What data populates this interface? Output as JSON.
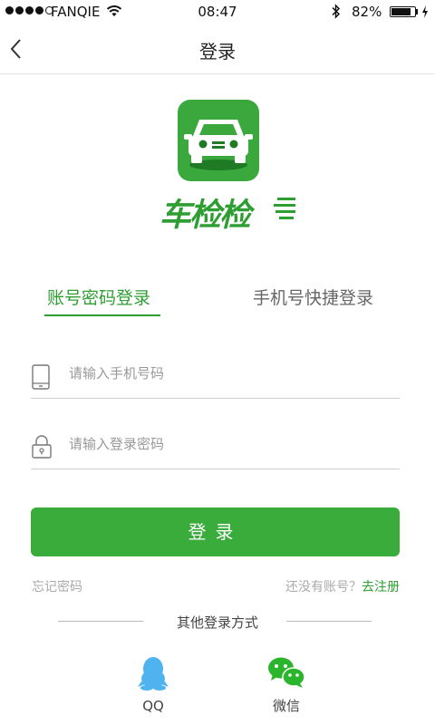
{
  "status_bar": {
    "carrier": "FANQIE",
    "time": "08:47",
    "battery": "82%"
  },
  "nav": {
    "title": "登录"
  },
  "brand": {
    "name": "车检检",
    "color": "#2e9e33"
  },
  "tabs": [
    {
      "label": "账号密码登录",
      "active": true
    },
    {
      "label": "手机号快捷登录",
      "active": false
    }
  ],
  "form": {
    "phone": {
      "value": "",
      "placeholder": "请输入手机号码"
    },
    "password": {
      "value": "",
      "placeholder": "请输入登录密码"
    },
    "submit_label": "登录"
  },
  "links": {
    "forgot": "忘记密码",
    "no_account": "还没有账号？",
    "register": "去注册"
  },
  "other_login": {
    "label": "其他登录方式",
    "options": [
      {
        "label": "QQ",
        "icon": "qq-icon"
      },
      {
        "label": "微信",
        "icon": "wechat-icon"
      }
    ]
  },
  "colors": {
    "accent": "#3aac3c",
    "accent_text": "#2e9e33",
    "qq": "#4fb3f0",
    "wechat": "#2bb52c"
  }
}
